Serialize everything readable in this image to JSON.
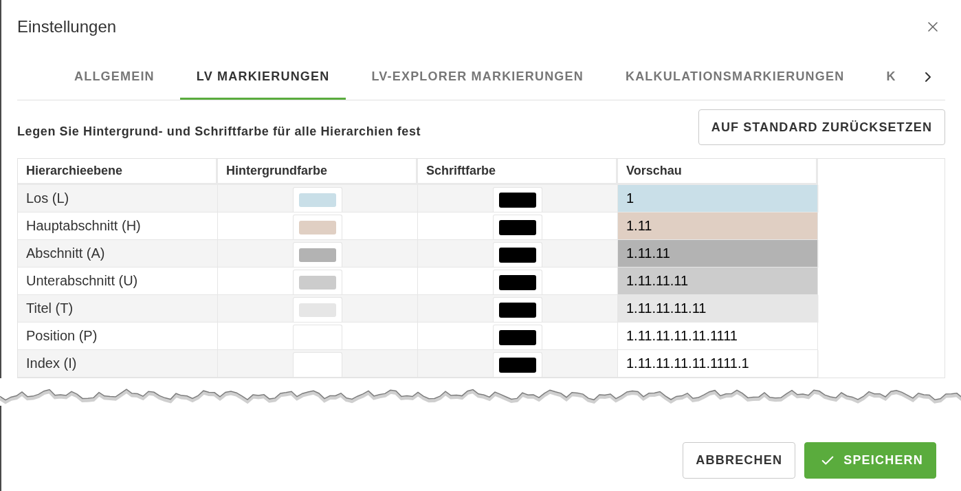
{
  "dialog": {
    "title": "Einstellungen"
  },
  "tabs": [
    {
      "label": "ALLGEMEIN",
      "selected": false
    },
    {
      "label": "LV MARKIERUNGEN",
      "selected": true
    },
    {
      "label": "LV-EXPLORER MARKIERUNGEN",
      "selected": false
    },
    {
      "label": "KALKULATIONSMARKIERUNGEN",
      "selected": false
    },
    {
      "label": "K",
      "selected": false
    }
  ],
  "description": "Legen Sie Hintergrund- und Schriftfarbe für alle Hierarchien fest",
  "reset_button": "AUF STANDARD ZURÜCKSETZEN",
  "table": {
    "columns": [
      "Hierarchieebene",
      "Hintergrundfarbe",
      "Schriftfarbe",
      "Vorschau"
    ],
    "rows": [
      {
        "name": "Los (L)",
        "background": {
          "color": "#c9dfe8"
        },
        "font": {
          "color": "#000000"
        },
        "preview": "1"
      },
      {
        "name": "Hauptabschnitt (H)",
        "background": {
          "color": "#e0cfc3"
        },
        "font": {
          "color": "#000000"
        },
        "preview": "1.11"
      },
      {
        "name": "Abschnitt (A)",
        "background": {
          "color": "#b3b3b3"
        },
        "font": {
          "color": "#000000"
        },
        "preview": "1.11.11"
      },
      {
        "name": "Unterabschnitt (U)",
        "background": {
          "color": "#cccccc"
        },
        "font": {
          "color": "#000000"
        },
        "preview": "1.11.11.11"
      },
      {
        "name": "Titel (T)",
        "background": {
          "color": "#e6e6e6"
        },
        "font": {
          "color": "#000000"
        },
        "preview": "1.11.11.11.11"
      },
      {
        "name": "Position (P)",
        "background": {
          "color": "#ffffff"
        },
        "font": {
          "color": "#000000"
        },
        "preview": "1.11.11.11.11.1111"
      },
      {
        "name": "Index (I)",
        "background": {
          "color": "#ffffff"
        },
        "font": {
          "color": "#000000"
        },
        "preview": "1.11.11.11.11.1111.1"
      }
    ]
  },
  "footer": {
    "buttons": [
      {
        "label": "ABBRECHEN",
        "kind": "secondary"
      },
      {
        "label": "SPEICHERN",
        "kind": "primary"
      }
    ]
  }
}
